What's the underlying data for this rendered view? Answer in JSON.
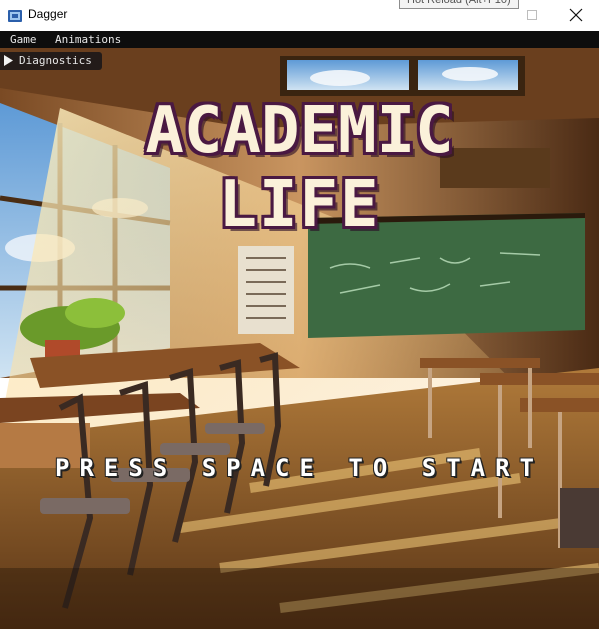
{
  "window": {
    "title": "Dagger",
    "tooltip": "Hot Reload (Alt+F10)"
  },
  "menu": {
    "items": [
      "Game",
      "Animations"
    ]
  },
  "overlay": {
    "diagnostics_label": "Diagnostics"
  },
  "game": {
    "title_line1": "ACADEMIC",
    "title_line2": "LIFE",
    "prompt": "PRESS SPACE TO START"
  },
  "colors": {
    "title_fill": "#fbf1da",
    "title_outline": "#4a1942",
    "menubar": "#0d0d0d"
  },
  "icons": [
    "app-icon",
    "maximize-icon",
    "close-icon",
    "expand-arrow-icon"
  ]
}
